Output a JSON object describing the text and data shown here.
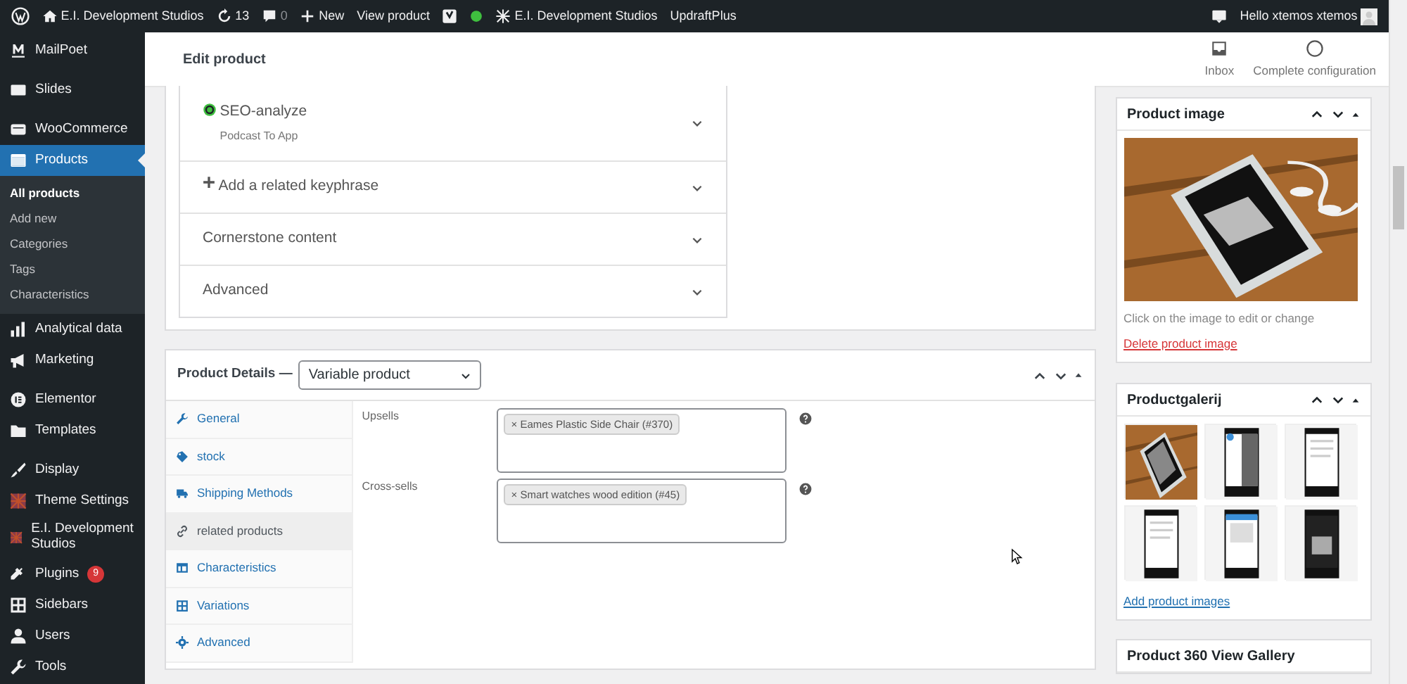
{
  "admin_bar": {
    "items": [
      {
        "kind": "wp"
      },
      {
        "kind": "home",
        "label": "E.I. Development Studios"
      },
      {
        "kind": "updates",
        "label": "13"
      },
      {
        "kind": "comments",
        "label": "0"
      },
      {
        "kind": "new",
        "label": "New"
      },
      {
        "kind": "text",
        "label": "View product"
      },
      {
        "kind": "yoast"
      },
      {
        "kind": "dot",
        "color": "#3fbf3f"
      },
      {
        "kind": "theme",
        "label": "E.I. Development Studios"
      },
      {
        "kind": "text",
        "label": "UpdraftPlus"
      }
    ],
    "greeting": "Hello xtemos xtemos"
  },
  "sidebar": {
    "items": [
      {
        "kind": "mail",
        "label": "MailPoet",
        "selected": false
      },
      {
        "kind": "slides",
        "label": "Slides",
        "selected": false
      },
      {
        "kind": "woo",
        "label": "WooCommerce",
        "selected": false
      },
      {
        "kind": "box",
        "label": "Products",
        "selected": true,
        "children": [
          {
            "label": "All products",
            "selected": true
          },
          {
            "label": "Add new",
            "selected": false
          },
          {
            "label": "Categories",
            "selected": false
          },
          {
            "label": "Tags",
            "selected": false
          },
          {
            "label": "Characteristics",
            "selected": false
          }
        ]
      },
      {
        "kind": "bars",
        "label": "Analytical data",
        "selected": false
      },
      {
        "kind": "megaphone",
        "label": "Marketing",
        "selected": false
      },
      {
        "kind": "circle",
        "label": "Elementor",
        "selected": false
      },
      {
        "kind": "folder",
        "label": "Templates",
        "selected": false
      },
      {
        "kind": "brush",
        "label": "Display",
        "selected": false
      },
      {
        "kind": "pattern",
        "label": "Theme Settings",
        "selected": false
      },
      {
        "kind": "pattern",
        "label": "E.I. Development Studios",
        "selected": false
      },
      {
        "kind": "plug",
        "label": "Plugins",
        "selected": false,
        "badge": "9"
      },
      {
        "kind": "grid",
        "label": "Sidebars",
        "selected": false
      },
      {
        "kind": "user",
        "label": "Users",
        "selected": false
      },
      {
        "kind": "wrench",
        "label": "Tools",
        "selected": false
      }
    ]
  },
  "header": {
    "title": "Edit product",
    "actions": [
      {
        "kind": "inbox",
        "label": "Inbox"
      },
      {
        "kind": "ring",
        "label": "Complete configuration"
      }
    ]
  },
  "seo_panel": {
    "rows": [
      {
        "kind": "score",
        "title": "SEO-analyze",
        "subtitle": "Podcast To App",
        "color": "#3fbf3f"
      },
      {
        "kind": "add",
        "title": "Add a related keyphrase"
      },
      {
        "kind": "plain",
        "title": "Cornerstone content"
      },
      {
        "kind": "plain",
        "title": "Advanced"
      }
    ]
  },
  "product_details": {
    "title": "Product Details —",
    "type": "Variable product",
    "tabs": [
      {
        "kind": "wrench",
        "label": "General",
        "selected": false
      },
      {
        "kind": "tag",
        "label": "stock",
        "selected": false
      },
      {
        "kind": "truck",
        "label": "Shipping Methods",
        "selected": false
      },
      {
        "kind": "link",
        "label": "related products",
        "selected": true
      },
      {
        "kind": "table",
        "label": "Characteristics",
        "selected": false
      },
      {
        "kind": "grid",
        "label": "Variations",
        "selected": false
      },
      {
        "kind": "gear",
        "label": "Advanced",
        "selected": false
      }
    ],
    "fields": [
      {
        "label": "Upsells",
        "tags": [
          "× Eames Plastic Side Chair (#370)"
        ]
      },
      {
        "label": "Cross-sells",
        "tags": [
          "× Smart watches wood edition (#45)"
        ]
      }
    ]
  },
  "product_image": {
    "title": "Product image",
    "hint": "Click on the image to edit or change",
    "link": "Delete product image"
  },
  "gallery": {
    "title": "Productgalerij",
    "link": "Add product images"
  },
  "gallery_360": {
    "title": "Product 360 View Gallery"
  }
}
